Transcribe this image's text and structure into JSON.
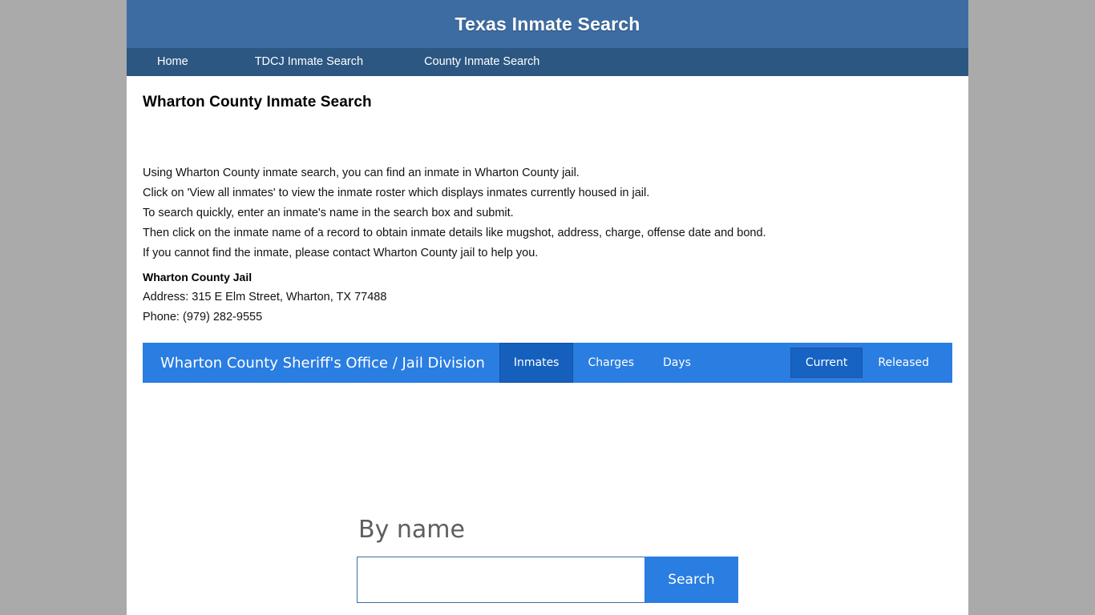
{
  "header": {
    "title": "Texas Inmate Search"
  },
  "nav": {
    "items": [
      {
        "label": "Home"
      },
      {
        "label": "TDCJ Inmate Search"
      },
      {
        "label": "County Inmate Search"
      }
    ]
  },
  "main": {
    "heading": "Wharton County Inmate Search",
    "intro_lines": [
      "Using Wharton County inmate search, you can find an inmate in Wharton County jail.",
      "Click on 'View all inmates' to view the inmate roster which displays inmates currently housed in jail.",
      "To search quickly, enter an inmate's name in the search box and submit.",
      "Then click on the inmate name of a record to obtain inmate details like mugshot, address, charge, offense date and bond.",
      "If you cannot find the inmate, please contact Wharton County jail to help you."
    ],
    "jail": {
      "name": "Wharton County Jail",
      "address": "Address: 315 E Elm Street, Wharton, TX 77488",
      "phone": "Phone: (979) 282-9555"
    }
  },
  "toolbar": {
    "brand": "Wharton County Sheriff's Office / Jail Division",
    "left_tabs": [
      {
        "label": "Inmates",
        "active": true
      },
      {
        "label": "Charges",
        "active": false
      },
      {
        "label": "Days",
        "active": false
      }
    ],
    "right_tabs": [
      {
        "label": "Current",
        "active": true
      },
      {
        "label": "Released",
        "active": false
      }
    ],
    "colors": {
      "bar": "#2a7de1",
      "active_tab": "#1560bd"
    }
  },
  "search": {
    "label": "By name",
    "input_value": "",
    "input_placeholder": "",
    "button_label": "Search"
  }
}
